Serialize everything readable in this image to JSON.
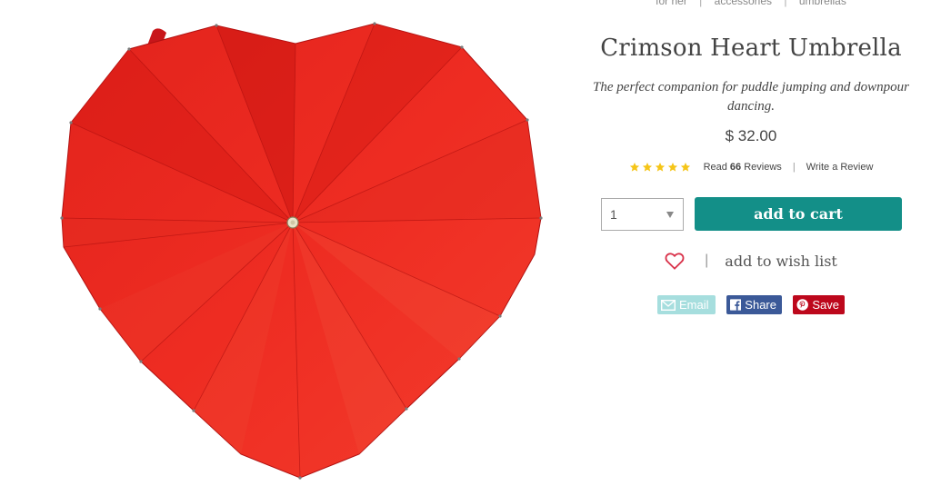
{
  "breadcrumb": {
    "items": [
      "for her",
      "accessories",
      "umbrellas"
    ],
    "separator": "|"
  },
  "product": {
    "title": "Crimson Heart Umbrella",
    "tagline": "The perfect companion for puddle jumping and downpour dancing.",
    "price": "$ 32.00",
    "image_icon": "heart-umbrella-image"
  },
  "rating": {
    "stars": 5,
    "star_color": "#f5c518",
    "read_prefix": "Read",
    "review_count": "66",
    "read_suffix": "Reviews",
    "separator": "|",
    "write_review": "Write a Review"
  },
  "purchase": {
    "quantity": "1",
    "add_to_cart": "add to cart",
    "button_color": "#138f88"
  },
  "wishlist": {
    "separator": "|",
    "label": "add to wish list",
    "heart_color": "#d9324a"
  },
  "share": {
    "email": "Email",
    "facebook": "Share",
    "pinterest": "Save"
  }
}
